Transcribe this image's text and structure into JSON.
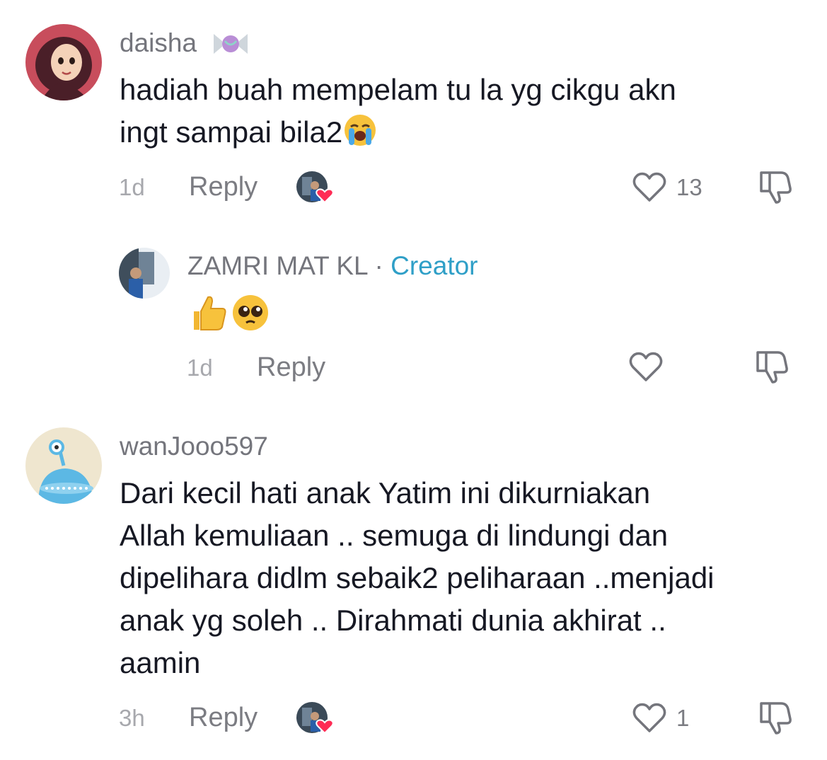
{
  "comments": [
    {
      "username": "daisha",
      "username_badge_icon": "candy-icon",
      "text_lines": [
        "hadiah buah mempelam tu la yg cikgu akn",
        "ingt sampai bila2"
      ],
      "text_trailing_emoji": "loudly-crying-face-emoji",
      "time": "1d",
      "reply_label": "Reply",
      "creator_liked": true,
      "like_count": "13",
      "replies": [
        {
          "username": "ZAMRI MAT KL",
          "separator": "·",
          "creator_label": "Creator",
          "emojis": [
            "thumbs-up-emoji",
            "pleading-face-emoji"
          ],
          "time": "1d",
          "reply_label": "Reply",
          "like_count": ""
        }
      ]
    },
    {
      "username": "wanJooo597",
      "text_lines": [
        "Dari kecil hati anak Yatim ini dikurniakan",
        "Allah kemuliaan .. semuga di lindungi dan",
        "dipelihara didlm sebaik2 peliharaan ..menjadi",
        "anak yg soleh .. Dirahmati dunia akhirat ..",
        "aamin"
      ],
      "time": "3h",
      "reply_label": "Reply",
      "creator_liked": true,
      "like_count": "1"
    }
  ],
  "colors": {
    "text": "#161823",
    "muted": "#74757c",
    "time": "#a7a8ad",
    "creator": "#2f9fc7",
    "heart_red": "#fe2c55"
  }
}
